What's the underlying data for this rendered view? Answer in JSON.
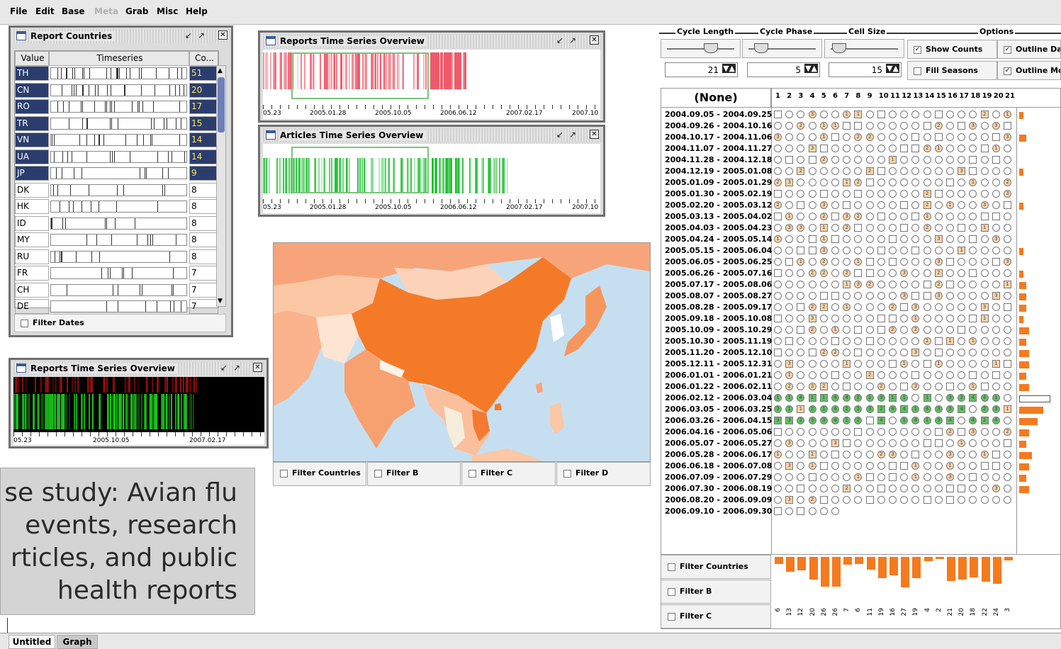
{
  "menu": {
    "items": [
      "File",
      "Edit",
      "Base",
      "Meta",
      "Grab",
      "Misc",
      "Help"
    ],
    "disabled": [
      "Meta"
    ]
  },
  "report_countries": {
    "title": "Report Countries",
    "columns": [
      "Value",
      "Timeseries",
      "Co..."
    ],
    "rows": [
      {
        "value": "TH",
        "count": "51",
        "selected": true
      },
      {
        "value": "CN",
        "count": "20",
        "selected": true
      },
      {
        "value": "RO",
        "count": "17",
        "selected": true
      },
      {
        "value": "TR",
        "count": "15",
        "selected": true
      },
      {
        "value": "VN",
        "count": "14",
        "selected": true
      },
      {
        "value": "UA",
        "count": "14",
        "selected": true
      },
      {
        "value": "JP",
        "count": "9",
        "selected": true
      },
      {
        "value": "DK",
        "count": "8",
        "selected": false
      },
      {
        "value": "HK",
        "count": "8",
        "selected": false
      },
      {
        "value": "ID",
        "count": "8",
        "selected": false
      },
      {
        "value": "MY",
        "count": "8",
        "selected": false
      },
      {
        "value": "RU",
        "count": "8",
        "selected": false
      },
      {
        "value": "FR",
        "count": "7",
        "selected": false
      },
      {
        "value": "CH",
        "count": "7",
        "selected": false
      },
      {
        "value": "DE",
        "count": "7",
        "selected": false
      }
    ],
    "filter_label": "Filter Dates"
  },
  "reports_overview": {
    "title": "Reports Time Series Overview",
    "axis_labels": [
      "05.23",
      "2005.01.28",
      "2005.10.05",
      "2006.06.12",
      "2007.02.17",
      "2007.10"
    ]
  },
  "articles_overview": {
    "title": "Articles Time Series Overview",
    "axis_labels": [
      "05.23",
      "2005.01.28",
      "2005.10.05",
      "2006.06.12",
      "2007.02.17",
      "2007.10"
    ]
  },
  "reports_overview_small": {
    "title": "Reports Time Series Overview",
    "axis_labels": [
      "05.23",
      "2005.10.05",
      "2007.02.17"
    ]
  },
  "map_filters": [
    "Filter Countries",
    "Filter B",
    "Filter C",
    "Filter D"
  ],
  "calendar": {
    "groups": [
      "Cycle Length",
      "Cycle Phase",
      "Cell Size",
      "Options"
    ],
    "values": {
      "cycle_length": "21",
      "cycle_phase": "5",
      "cell_size": "15"
    },
    "options": [
      {
        "label": "Show Counts",
        "checked": true
      },
      {
        "label": "Outline Dates",
        "checked": true
      },
      {
        "label": "Fill Seasons",
        "checked": false
      },
      {
        "label": "Outline Months",
        "checked": true
      }
    ],
    "none_label": "(None)",
    "day_numbers": [
      "1",
      "2",
      "3",
      "4",
      "5",
      "6",
      "7",
      "8",
      "9",
      "10",
      "11",
      "12",
      "13",
      "14",
      "15",
      "16",
      "17",
      "18",
      "19",
      "20",
      "21"
    ],
    "date_rows": [
      "2004.09.05 - 2004.09.25",
      "2004.09.26 - 2004.10.16",
      "2004.10.17 - 2004.11.06",
      "2004.11.07 - 2004.11.27",
      "2004.11.28 - 2004.12.18",
      "2004.12.19 - 2005.01.08",
      "2005.01.09 - 2005.01.29",
      "2005.01.30 - 2005.02.19",
      "2005.02.20 - 2005.03.12",
      "2005.03.13 - 2005.04.02",
      "2005.04.03 - 2005.04.23",
      "2005.04.24 - 2005.05.14",
      "2005.05.15 - 2005.06.04",
      "2005.06.05 - 2005.06.25",
      "2005.06.26 - 2005.07.16",
      "2005.07.17 - 2005.08.06",
      "2005.08.07 - 2005.08.27",
      "2005.08.28 - 2005.09.17",
      "2005.09.18 - 2005.10.08",
      "2005.10.09 - 2005.10.29",
      "2005.10.30 - 2005.11.19",
      "2005.11.20 - 2005.12.10",
      "2005.12.11 - 2005.12.31",
      "2006.01.01 - 2006.01.21",
      "2006.01.22 - 2006.02.11",
      "2006.02.12 - 2006.03.04",
      "2006.03.05 - 2006.03.25",
      "2006.03.26 - 2006.04.15",
      "2006.04.16 - 2006.05.06",
      "2006.05.07 - 2006.05.27",
      "2006.05.28 - 2006.06.17",
      "2006.06.18 - 2006.07.08",
      "2006.07.09 - 2006.07.29",
      "2006.07.30 - 2006.08.19",
      "2006.08.20 - 2006.09.09",
      "2006.09.10 - 2006.09.30"
    ],
    "bottom_counts": [
      "6",
      "13",
      "12",
      "20",
      "26",
      "26",
      "7",
      "6",
      "11",
      "19",
      "16",
      "27",
      "19",
      "4",
      "2",
      "21",
      "20",
      "18",
      "22",
      "24",
      "3"
    ],
    "filters": [
      "Filter Countries",
      "Filter B",
      "Filter C"
    ]
  },
  "caption": "se study: Avian flu\nevents, research\nrticles, and public\nhealth reports",
  "tabs": [
    "Untitled",
    "Graph"
  ]
}
